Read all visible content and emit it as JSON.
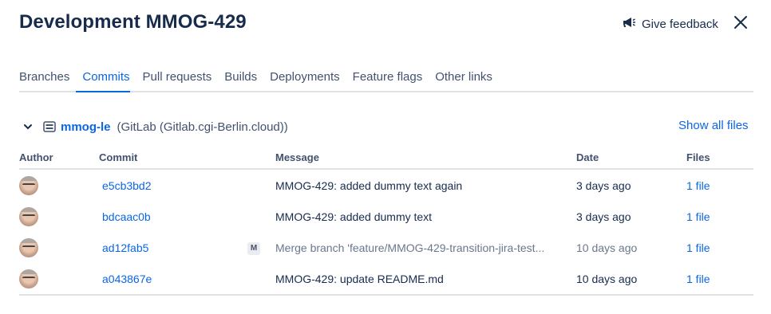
{
  "header": {
    "title": "Development MMOG-429",
    "feedback_label": "Give feedback"
  },
  "tabs": [
    {
      "label": "Branches",
      "active": false
    },
    {
      "label": "Commits",
      "active": true
    },
    {
      "label": "Pull requests",
      "active": false
    },
    {
      "label": "Builds",
      "active": false
    },
    {
      "label": "Deployments",
      "active": false
    },
    {
      "label": "Feature flags",
      "active": false
    },
    {
      "label": "Other links",
      "active": false
    }
  ],
  "repository": {
    "name": "mmog-le",
    "host": "(GitLab (Gitlab.cgi-Berlin.cloud))",
    "show_all_files": "Show all files"
  },
  "table": {
    "columns": {
      "author": "Author",
      "commit": "Commit",
      "message": "Message",
      "date": "Date",
      "files": "Files"
    },
    "rows": [
      {
        "hash": "e5cb3bd2",
        "badge": "",
        "message": "MMOG-429: added dummy text again",
        "date": "3 days ago",
        "files": "1 file"
      },
      {
        "hash": "bdcaac0b",
        "badge": "",
        "message": "MMOG-429: added dummy text",
        "date": "3 days ago",
        "files": "1 file"
      },
      {
        "hash": "ad12fab5",
        "badge": "M",
        "message": "Merge branch 'feature/MMOG-429-transition-jira-test...",
        "date": "10 days ago",
        "files": "1 file"
      },
      {
        "hash": "a043867e",
        "badge": "",
        "message": "MMOG-429: update README.md",
        "date": "10 days ago",
        "files": "1 file"
      }
    ]
  },
  "colors": {
    "link": "#0c66e4",
    "text": "#172b4d",
    "subtle": "#42526e",
    "border": "#dfe1e6"
  }
}
